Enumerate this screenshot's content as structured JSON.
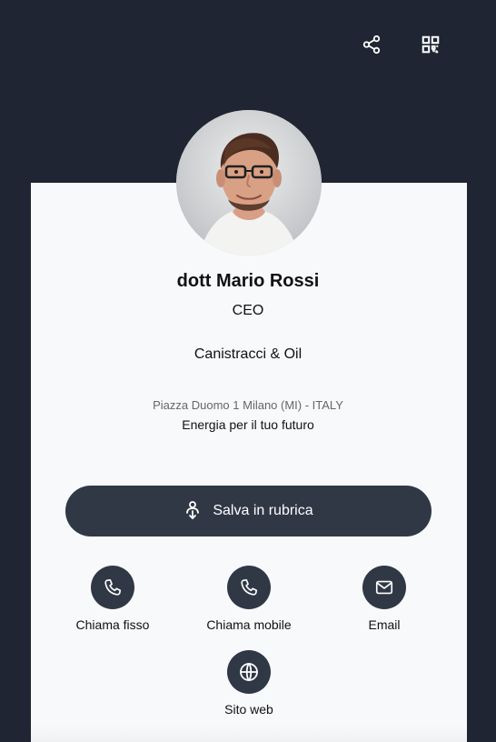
{
  "topbar": {
    "share_icon": "share-icon",
    "qr_icon": "qr-code-icon"
  },
  "profile": {
    "name": "dott Mario Rossi",
    "role": "CEO",
    "company": "Canistracci & Oil",
    "address": "Piazza Duomo 1 Milano (MI) - ITALY",
    "slogan": "Energia per il tuo futuro"
  },
  "save_contact": {
    "label": "Salva in rubrica",
    "icon": "person-download-icon"
  },
  "actions": [
    {
      "label": "Chiama fisso",
      "icon": "phone-icon"
    },
    {
      "label": "Chiama mobile",
      "icon": "phone-icon"
    },
    {
      "label": "Email",
      "icon": "mail-icon"
    },
    {
      "label": "Sito web",
      "icon": "globe-icon"
    }
  ],
  "colors": {
    "header_background": "#1f2533",
    "button_background": "#303846",
    "card_background": "#f8f9fb"
  }
}
